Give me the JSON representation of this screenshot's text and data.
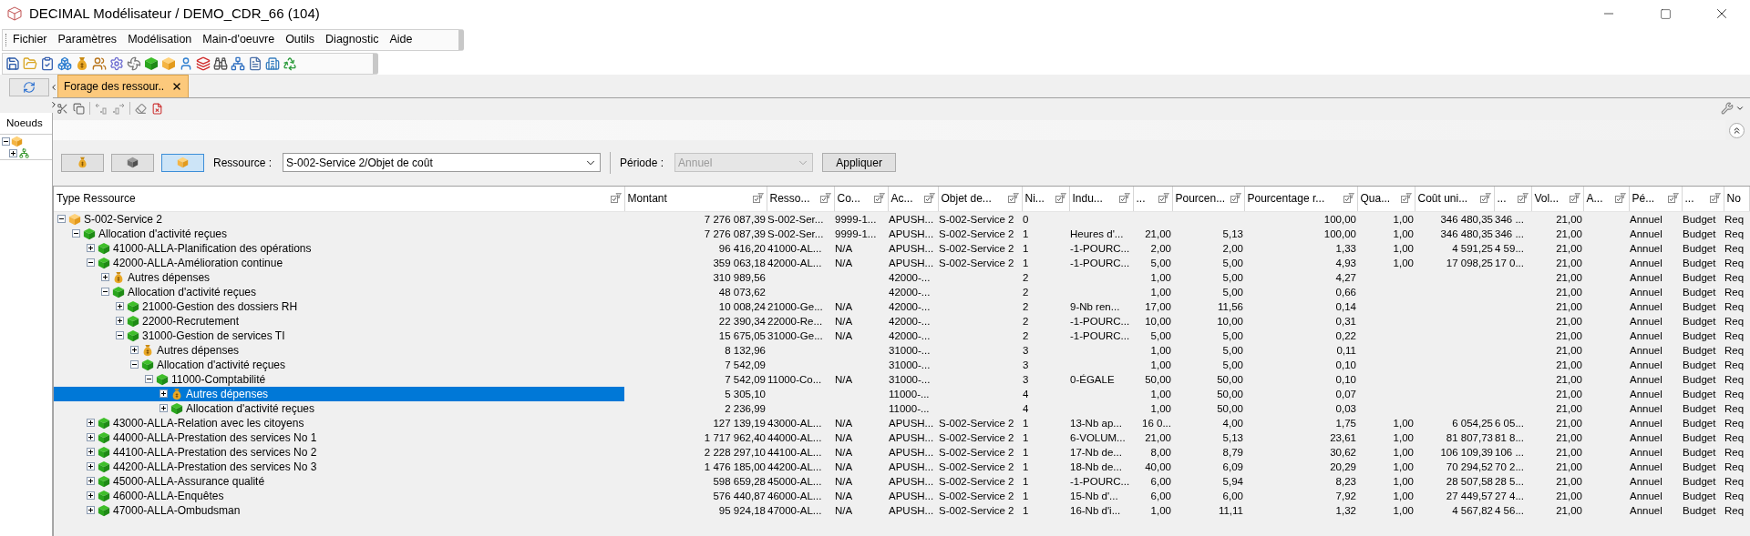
{
  "window": {
    "title": "DECIMAL Modélisateur / DEMO_CDR_66 (104)"
  },
  "menu": [
    "Fichier",
    "Paramètres",
    "Modélisation",
    "Main-d'oeuvre",
    "Outils",
    "Diagnostic",
    "Aide"
  ],
  "side_panel": {
    "tab": "Noeuds"
  },
  "tabs": [
    {
      "label": "Forage des ressour..",
      "selected": true
    }
  ],
  "filter": {
    "resource_buttons": [
      {
        "kind": "money-bag",
        "selected": false
      },
      {
        "kind": "cube-grey",
        "selected": false
      },
      {
        "kind": "cube-orange",
        "selected": true
      }
    ],
    "resource_label": "Ressource :",
    "resource_value": "S-002-Service 2/Objet de coût",
    "period_label": "Période :",
    "period_value": "Annuel",
    "period_disabled": true,
    "apply": "Appliquer"
  },
  "table": {
    "columns": [
      {
        "label": "Type Ressource"
      },
      {
        "label": "Montant"
      },
      {
        "label": "Resso..."
      },
      {
        "label": "Co..."
      },
      {
        "label": "Ac..."
      },
      {
        "label": "Objet de..."
      },
      {
        "label": "Ni..."
      },
      {
        "label": "Indu..."
      },
      {
        "label": "..."
      },
      {
        "label": "Pourcen..."
      },
      {
        "label": "Pourcentage r..."
      },
      {
        "label": "Qua..."
      },
      {
        "label": "Coût uni..."
      },
      {
        "label": "..."
      },
      {
        "label": "Vol..."
      },
      {
        "label": "A..."
      },
      {
        "label": "Pé..."
      },
      {
        "label": "..."
      },
      {
        "label": "No"
      }
    ],
    "rows": [
      {
        "kind": "cube-orange",
        "expanded": true,
        "selected": false,
        "cells": [
          "S-002-Service 2",
          "7 276 087,39",
          "S-002-Ser...",
          "9999-1...",
          "APUSH...",
          "S-002-Service 2",
          "0",
          "",
          "",
          "",
          "100,00",
          "1,00",
          "346 480,35",
          "346 ...",
          "21,00",
          "",
          "Annuel",
          "Budget",
          "Req"
        ],
        "children": [
          {
            "kind": "cube-green",
            "expanded": true,
            "selected": false,
            "cells": [
              "Allocation d'activité reçues",
              "7 276 087,39",
              "S-002-Ser...",
              "9999-1...",
              "APUSH...",
              "S-002-Service 2",
              "1",
              "Heures d'...",
              "21,00",
              "5,13",
              "100,00",
              "1,00",
              "346 480,35",
              "346 ...",
              "21,00",
              "",
              "Annuel",
              "Budget",
              "Req"
            ],
            "children": [
              {
                "kind": "cube-green",
                "expanded": false,
                "selected": false,
                "cells": [
                  "41000-ALLA-Planification des opérations",
                  "96 416,20",
                  "41000-AL...",
                  "N/A",
                  "APUSH...",
                  "S-002-Service 2",
                  "1",
                  "-1-POURC...",
                  "2,00",
                  "2,00",
                  "1,33",
                  "1,00",
                  "4 591,25",
                  "4 59...",
                  "21,00",
                  "",
                  "Annuel",
                  "Budget",
                  "Req"
                ]
              },
              {
                "kind": "cube-green",
                "expanded": true,
                "selected": false,
                "cells": [
                  "42000-ALLA-Amélioration continue",
                  "359 063,18",
                  "42000-AL...",
                  "N/A",
                  "APUSH...",
                  "S-002-Service 2",
                  "1",
                  "-1-POURC...",
                  "5,00",
                  "5,00",
                  "4,93",
                  "1,00",
                  "17 098,25",
                  "17 0...",
                  "21,00",
                  "",
                  "Annuel",
                  "Budget",
                  "Req"
                ],
                "children": [
                  {
                    "kind": "money-bag",
                    "expanded": false,
                    "selected": false,
                    "cells": [
                      "Autres dépenses",
                      "310 989,56",
                      "",
                      "",
                      "42000-...",
                      "",
                      "2",
                      "",
                      "1,00",
                      "5,00",
                      "4,27",
                      "",
                      "",
                      "",
                      "21,00",
                      "",
                      "Annuel",
                      "Budget",
                      "Req"
                    ]
                  },
                  {
                    "kind": "cube-green",
                    "expanded": true,
                    "selected": false,
                    "cells": [
                      "Allocation d'activité reçues",
                      "48 073,62",
                      "",
                      "",
                      "42000-...",
                      "",
                      "2",
                      "",
                      "1,00",
                      "5,00",
                      "0,66",
                      "",
                      "",
                      "",
                      "21,00",
                      "",
                      "Annuel",
                      "Budget",
                      "Req"
                    ],
                    "children": [
                      {
                        "kind": "cube-green",
                        "expanded": false,
                        "selected": false,
                        "cells": [
                          "21000-Gestion des dossiers RH",
                          "10 008,24",
                          "21000-Ge...",
                          "N/A",
                          "42000-...",
                          "",
                          "2",
                          "9-Nb ren...",
                          "17,00",
                          "11,56",
                          "0,14",
                          "",
                          "",
                          "",
                          "21,00",
                          "",
                          "Annuel",
                          "Budget",
                          "Req"
                        ]
                      },
                      {
                        "kind": "cube-green",
                        "expanded": false,
                        "selected": false,
                        "cells": [
                          "22000-Recrutement",
                          "22 390,34",
                          "22000-Re...",
                          "N/A",
                          "42000-...",
                          "",
                          "2",
                          "-1-POURC...",
                          "10,00",
                          "10,00",
                          "0,31",
                          "",
                          "",
                          "",
                          "21,00",
                          "",
                          "Annuel",
                          "Budget",
                          "Req"
                        ]
                      },
                      {
                        "kind": "cube-green",
                        "expanded": true,
                        "selected": false,
                        "cells": [
                          "31000-Gestion de services TI",
                          "15 675,05",
                          "31000-Ge...",
                          "N/A",
                          "42000-...",
                          "",
                          "2",
                          "-1-POURC...",
                          "5,00",
                          "5,00",
                          "0,22",
                          "",
                          "",
                          "",
                          "21,00",
                          "",
                          "Annuel",
                          "Budget",
                          "Req"
                        ],
                        "children": [
                          {
                            "kind": "money-bag",
                            "expanded": false,
                            "selected": false,
                            "cells": [
                              "Autres dépenses",
                              "8 132,96",
                              "",
                              "",
                              "31000-...",
                              "",
                              "3",
                              "",
                              "1,00",
                              "5,00",
                              "0,11",
                              "",
                              "",
                              "",
                              "21,00",
                              "",
                              "Annuel",
                              "Budget",
                              "Req"
                            ]
                          },
                          {
                            "kind": "cube-green",
                            "expanded": true,
                            "selected": false,
                            "cells": [
                              "Allocation d'activité reçues",
                              "7 542,09",
                              "",
                              "",
                              "31000-...",
                              "",
                              "3",
                              "",
                              "1,00",
                              "5,00",
                              "0,10",
                              "",
                              "",
                              "",
                              "21,00",
                              "",
                              "Annuel",
                              "Budget",
                              "Req"
                            ],
                            "children": [
                              {
                                "kind": "cube-green",
                                "expanded": true,
                                "selected": false,
                                "cells": [
                                  "11000-Comptabilité",
                                  "7 542,09",
                                  "11000-Co...",
                                  "N/A",
                                  "31000-...",
                                  "",
                                  "3",
                                  "0-ÉGALE",
                                  "50,00",
                                  "50,00",
                                  "0,10",
                                  "",
                                  "",
                                  "",
                                  "21,00",
                                  "",
                                  "Annuel",
                                  "Budget",
                                  "Req"
                                ],
                                "children": [
                                  {
                                    "kind": "money-bag",
                                    "expanded": false,
                                    "selected": true,
                                    "cells": [
                                      "Autres dépenses",
                                      "5 305,10",
                                      "",
                                      "",
                                      "11000-...",
                                      "",
                                      "4",
                                      "",
                                      "1,00",
                                      "50,00",
                                      "0,07",
                                      "",
                                      "",
                                      "",
                                      "21,00",
                                      "",
                                      "Annuel",
                                      "Budget",
                                      "Req"
                                    ]
                                  },
                                  {
                                    "kind": "cube-green",
                                    "expanded": false,
                                    "selected": false,
                                    "cells": [
                                      "Allocation d'activité reçues",
                                      "2 236,99",
                                      "",
                                      "",
                                      "11000-...",
                                      "",
                                      "4",
                                      "",
                                      "1,00",
                                      "50,00",
                                      "0,03",
                                      "",
                                      "",
                                      "",
                                      "21,00",
                                      "",
                                      "Annuel",
                                      "Budget",
                                      "Req"
                                    ]
                                  }
                                ]
                              }
                            ]
                          }
                        ]
                      }
                    ]
                  }
                ]
              },
              {
                "kind": "cube-green",
                "expanded": false,
                "selected": false,
                "cells": [
                  "43000-ALLA-Relation avec les citoyens",
                  "127 139,19",
                  "43000-AL...",
                  "N/A",
                  "APUSH...",
                  "S-002-Service 2",
                  "1",
                  "13-Nb ap...",
                  "16 0...",
                  "4,00",
                  "1,75",
                  "1,00",
                  "6 054,25",
                  "6 05...",
                  "21,00",
                  "",
                  "Annuel",
                  "Budget",
                  "Req"
                ]
              },
              {
                "kind": "cube-green",
                "expanded": false,
                "selected": false,
                "cells": [
                  "44000-ALLA-Prestation des services No 1",
                  "1 717 962,40",
                  "44000-AL...",
                  "N/A",
                  "APUSH...",
                  "S-002-Service 2",
                  "1",
                  "6-VOLUM...",
                  "21,00",
                  "5,13",
                  "23,61",
                  "1,00",
                  "81 807,73",
                  "81 8...",
                  "21,00",
                  "",
                  "Annuel",
                  "Budget",
                  "Req"
                ]
              },
              {
                "kind": "cube-green",
                "expanded": false,
                "selected": false,
                "cells": [
                  "44100-ALLA-Prestation des services No 2",
                  "2 228 297,10",
                  "44100-AL...",
                  "N/A",
                  "APUSH...",
                  "S-002-Service 2",
                  "1",
                  "17-Nb de...",
                  "8,00",
                  "8,79",
                  "30,62",
                  "1,00",
                  "106 109,39",
                  "106 ...",
                  "21,00",
                  "",
                  "Annuel",
                  "Budget",
                  "Req"
                ]
              },
              {
                "kind": "cube-green",
                "expanded": false,
                "selected": false,
                "cells": [
                  "44200-ALLA-Prestation des services No 3",
                  "1 476 185,00",
                  "44200-AL...",
                  "N/A",
                  "APUSH...",
                  "S-002-Service 2",
                  "1",
                  "18-Nb de...",
                  "40,00",
                  "6,09",
                  "20,29",
                  "1,00",
                  "70 294,52",
                  "70 2...",
                  "21,00",
                  "",
                  "Annuel",
                  "Budget",
                  "Req"
                ]
              },
              {
                "kind": "cube-green",
                "expanded": false,
                "selected": false,
                "cells": [
                  "45000-ALLA-Assurance qualité",
                  "598 659,28",
                  "45000-AL...",
                  "N/A",
                  "APUSH...",
                  "S-002-Service 2",
                  "1",
                  "-1-POURC...",
                  "6,00",
                  "5,94",
                  "8,23",
                  "1,00",
                  "28 507,58",
                  "28 5...",
                  "21,00",
                  "",
                  "Annuel",
                  "Budget",
                  "Req"
                ]
              },
              {
                "kind": "cube-green",
                "expanded": false,
                "selected": false,
                "cells": [
                  "46000-ALLA-Enquêtes",
                  "576 440,87",
                  "46000-AL...",
                  "N/A",
                  "APUSH...",
                  "S-002-Service 2",
                  "1",
                  "15-Nb d'...",
                  "6,00",
                  "6,00",
                  "7,92",
                  "1,00",
                  "27 449,57",
                  "27 4...",
                  "21,00",
                  "",
                  "Annuel",
                  "Budget",
                  "Req"
                ]
              },
              {
                "kind": "cube-green",
                "expanded": false,
                "selected": false,
                "cells": [
                  "47000-ALLA-Ombudsman",
                  "95 924,18",
                  "47000-AL...",
                  "N/A",
                  "APUSH...",
                  "S-002-Service 2",
                  "1",
                  "16-Nb d'i...",
                  "1,00",
                  "11,11",
                  "1,32",
                  "1,00",
                  "4 567,82",
                  "4 56...",
                  "21,00",
                  "",
                  "Annuel",
                  "Budget",
                  "Req"
                ]
              }
            ]
          }
        ]
      }
    ]
  }
}
